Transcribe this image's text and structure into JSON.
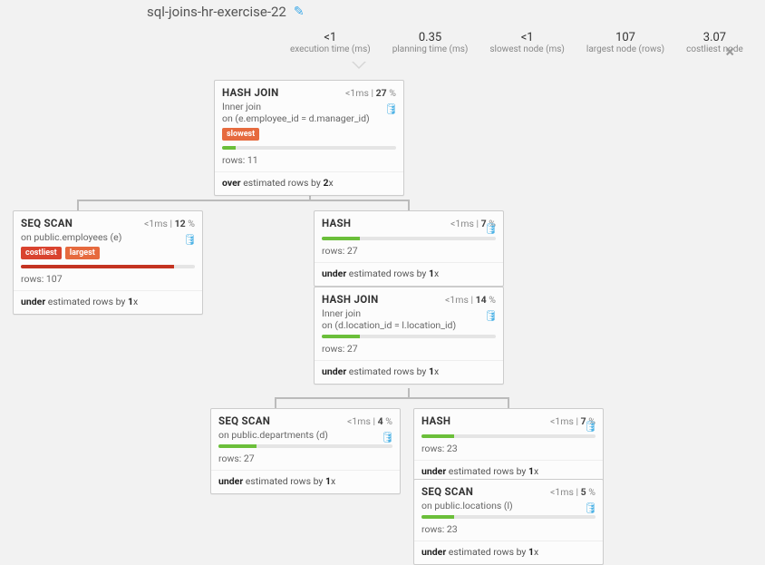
{
  "title": "sql-joins-hr-exercise-22",
  "stats": {
    "exec_val": "<1",
    "exec_lbl": "execution time (ms)",
    "plan_val": "0.35",
    "plan_lbl": "planning time (ms)",
    "slow_val": "<1",
    "slow_lbl": "slowest node (ms)",
    "large_val": "107",
    "large_lbl": "largest node (rows)",
    "cost_val": "3.07",
    "cost_lbl": "costliest node"
  },
  "nodes": {
    "n1": {
      "title": "HASH JOIN",
      "ms": "<1",
      "pct": "27",
      "sub1": "Inner join",
      "sub2": "on (e.employee_id = d.manager_id)",
      "badge1": "slowest",
      "rows": "rows: 11",
      "est_prefix": "over",
      "est_mid": " estimated rows by ",
      "est_x": "2"
    },
    "n2": {
      "title": "SEQ SCAN",
      "ms": "<1",
      "pct": "12",
      "sub1": "on public.employees (e)",
      "badge1": "costliest",
      "badge2": "largest",
      "rows": "rows: 107",
      "est_prefix": "under",
      "est_mid": " estimated rows by ",
      "est_x": "1"
    },
    "n3": {
      "title": "HASH",
      "ms": "<1",
      "pct": "7",
      "rows": "rows: 27",
      "est_prefix": "under",
      "est_mid": " estimated rows by ",
      "est_x": "1"
    },
    "n4": {
      "title": "HASH JOIN",
      "ms": "<1",
      "pct": "14",
      "sub1": "Inner join",
      "sub2": "on (d.location_id = l.location_id)",
      "rows": "rows: 27",
      "est_prefix": "under",
      "est_mid": " estimated rows by ",
      "est_x": "1"
    },
    "n5": {
      "title": "SEQ SCAN",
      "ms": "<1",
      "pct": "4",
      "sub1": "on public.departments (d)",
      "rows": "rows: 27",
      "est_prefix": "under",
      "est_mid": " estimated rows by ",
      "est_x": "1"
    },
    "n6": {
      "title": "HASH",
      "ms": "<1",
      "pct": "7",
      "rows": "rows: 23",
      "est_prefix": "under",
      "est_mid": " estimated rows by ",
      "est_x": "1"
    },
    "n7": {
      "title": "SEQ SCAN",
      "ms": "<1",
      "pct": "5",
      "sub1": "on public.locations (l)",
      "rows": "rows: 23",
      "est_prefix": "under",
      "est_mid": " estimated rows by ",
      "est_x": "1"
    }
  }
}
